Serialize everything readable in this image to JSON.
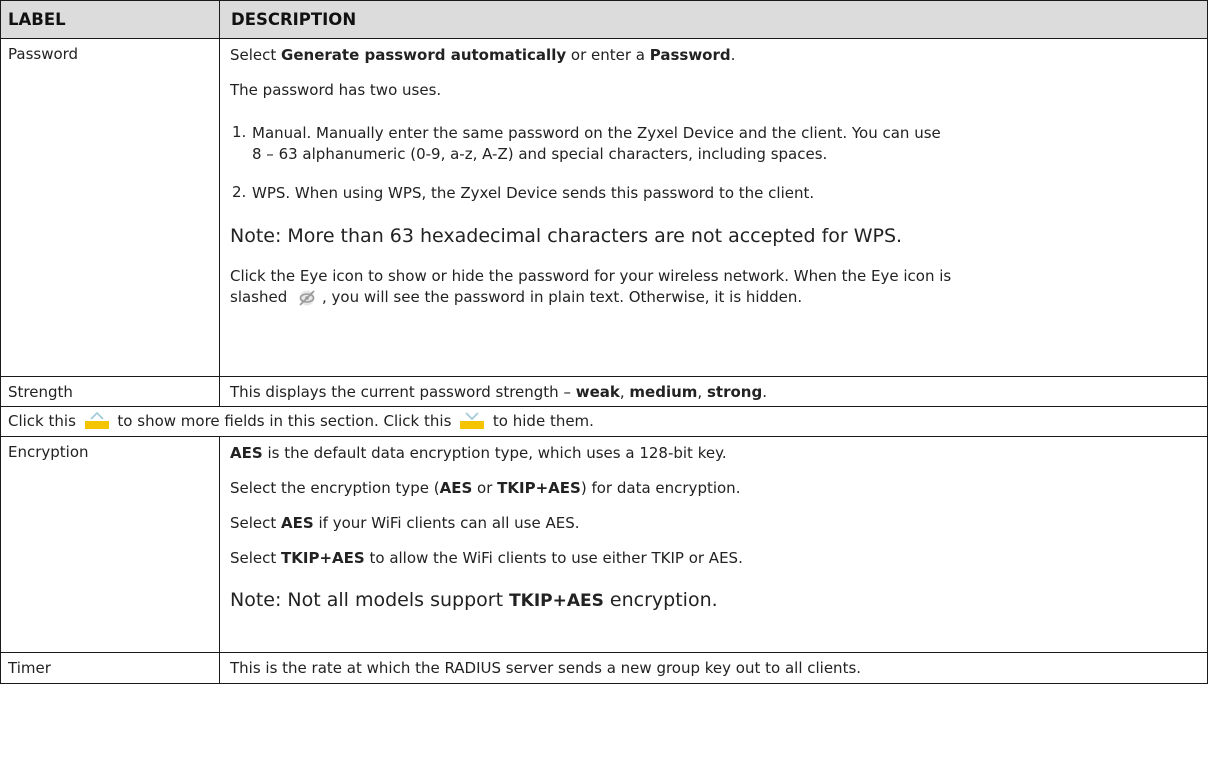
{
  "header": {
    "label": "LABEL",
    "description": "DESCRIPTION"
  },
  "password": {
    "label": "Password",
    "line1_a": "Select ",
    "line1_b": "Generate password automatically",
    "line1_c": " or enter a ",
    "line1_d": "Password",
    "line1_e": ".",
    "uses": "The password has two uses.",
    "item1_num": "1.",
    "item1_a": "Manual. Manually enter the same password on the Zyxel Device and the client. You can use",
    "item1_b": "8 – 63 alphanumeric (0-9, a-z, A-Z) and special characters, including spaces.",
    "item2_num": "2.",
    "item2": "WPS. When using WPS, the Zyxel Device sends this password to the client.",
    "note": "Note: More than 63 hexadecimal characters are not accepted for WPS.",
    "eye_a": "Click the Eye icon to show or hide the password for your wireless network. When the Eye icon is",
    "eye_b1": "slashed ",
    "eye_b2": ", you will see the password in plain text. Otherwise, it is hidden."
  },
  "strength": {
    "label": "Strength",
    "a": "This displays the current password strength – ",
    "weak": "weak",
    "sep1": ", ",
    "medium": "medium",
    "sep2": ", ",
    "strong": "strong",
    "end": "."
  },
  "fields_row": {
    "a": "Click this ",
    "b": " to show more fields in this section. Click this ",
    "c": " to hide them."
  },
  "encryption": {
    "label": "Encryption",
    "l1_aes": "AES",
    "l1_rest": " is the default data encryption type, which uses a 128-bit key.",
    "l2_a": "Select the encryption type (",
    "l2_aes": "AES",
    "l2_or": " or ",
    "l2_tkip": "TKIP+AES",
    "l2_b": ") for data encryption.",
    "l3_a": "Select ",
    "l3_aes": "AES",
    "l3_b": " if your WiFi clients can all use AES.",
    "l4_a": "Select ",
    "l4_tkip": "TKIP+AES",
    "l4_b": " to allow the WiFi clients to use either TKIP or AES.",
    "note_a": "Note: Not all models support ",
    "note_b": "TKIP+AES",
    "note_c": " encryption."
  },
  "timer": {
    "label": "Timer",
    "desc": "This is the rate at which the RADIUS server sends a new group key out to all clients."
  },
  "colors": {
    "header_bg": "#dcdcdc",
    "folder": "#f5c400",
    "eye": "#b9b9b9"
  },
  "icons": [
    "eye-slashed-icon",
    "folder-expand-icon",
    "folder-collapse-icon"
  ]
}
